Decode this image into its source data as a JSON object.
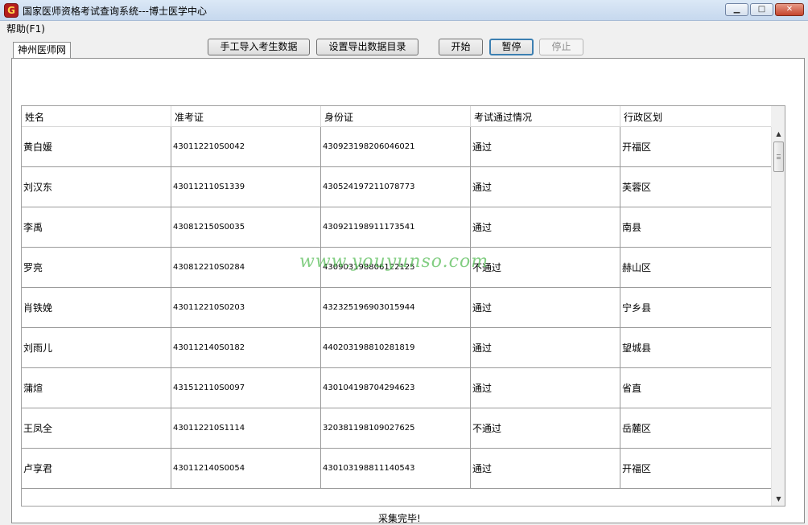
{
  "window": {
    "title": "国家医师资格考试查询系统---博士医学中心",
    "icon_label": "G",
    "minimize_glyph": "▁",
    "maximize_glyph": "□",
    "close_glyph": "✕"
  },
  "menu": {
    "help": "帮助(F1)"
  },
  "tab": {
    "label": "神州医师网"
  },
  "toolbar": {
    "import_label": "手工导入考生数据",
    "export_label": "设置导出数据目录",
    "start_label": "开始",
    "pause_label": "暂停",
    "stop_label": "停止"
  },
  "grid": {
    "columns": [
      "姓名",
      "准考证",
      "身份证",
      "考试通过情况",
      "行政区划"
    ],
    "rows": [
      {
        "name": "黄白媛",
        "exam_id": "430112210S0042",
        "id_card": "430923198206046021",
        "result": "通过",
        "region": "开福区"
      },
      {
        "name": "刘汉东",
        "exam_id": "430112110S1339",
        "id_card": "430524197211078773",
        "result": "通过",
        "region": "芙蓉区"
      },
      {
        "name": "李禹",
        "exam_id": "430812150S0035",
        "id_card": "430921198911173541",
        "result": "通过",
        "region": "南县"
      },
      {
        "name": "罗亮",
        "exam_id": "430812210S0284",
        "id_card": "430903198806122125",
        "result": "不通过",
        "region": "赫山区"
      },
      {
        "name": "肖铁娩",
        "exam_id": "430112210S0203",
        "id_card": "432325196903015944",
        "result": "通过",
        "region": "宁乡县"
      },
      {
        "name": "刘雨儿",
        "exam_id": "430112140S0182",
        "id_card": "440203198810281819",
        "result": "通过",
        "region": "望城县"
      },
      {
        "name": "蒲煊",
        "exam_id": "431512110S0097",
        "id_card": "430104198704294623",
        "result": "通过",
        "region": "省直"
      },
      {
        "name": "王凤全",
        "exam_id": "430112210S1114",
        "id_card": "320381198109027625",
        "result": "不通过",
        "region": "岳麓区"
      },
      {
        "name": "卢享君",
        "exam_id": "430112140S0054",
        "id_card": "430103198811140543",
        "result": "通过",
        "region": "开福区"
      }
    ]
  },
  "scrollbar": {
    "up_glyph": "▲",
    "down_glyph": "▼"
  },
  "watermark": "www.youyunso.com",
  "status": "采集完毕!"
}
